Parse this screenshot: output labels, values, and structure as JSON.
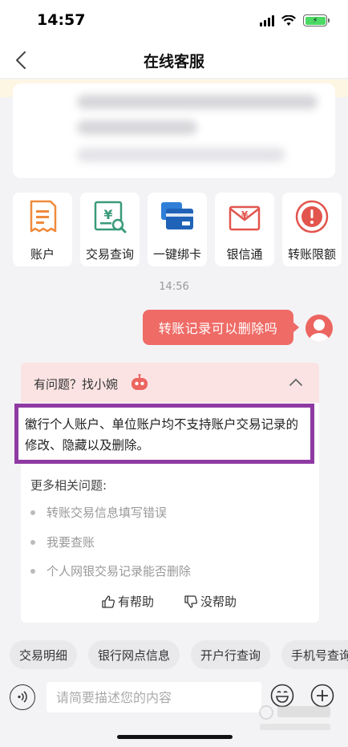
{
  "status_bar": {
    "time": "14:57"
  },
  "nav": {
    "title": "在线客服"
  },
  "quick_entries": [
    {
      "label": "账户",
      "icon": "account-doc-icon",
      "color": "#f08a3c"
    },
    {
      "label": "交易查询",
      "icon": "transaction-search-icon",
      "color": "#3a9a7a"
    },
    {
      "label": "一键绑卡",
      "icon": "bind-card-icon",
      "color": "#2f7fd8"
    },
    {
      "label": "银信通",
      "icon": "bank-message-icon",
      "color": "#e2554e"
    },
    {
      "label": "转账限额",
      "icon": "transfer-limit-icon",
      "color": "#e2554e"
    }
  ],
  "chat": {
    "time": "14:56",
    "user_message": "转账记录可以删除吗",
    "answer_header": "有问题？找小婉",
    "answer_text": "徽行个人账户、单位账户均不支持账户交易记录的修改、隐藏以及删除。",
    "related_title": "更多相关问题:",
    "related_questions": [
      "转账交易信息填写错误",
      "我要查账",
      "个人网银交易记录能否删除"
    ],
    "helpful_label": "有帮助",
    "not_helpful_label": "没帮助"
  },
  "chips": [
    "交易明细",
    "银行网点信息",
    "开户行查询",
    "手机号查询"
  ],
  "input": {
    "placeholder": "请简要描述您的内容"
  },
  "colors": {
    "accent": "#ef6b66",
    "highlight_border": "#8f3aa3",
    "header_bg": "#fbe3e3"
  }
}
